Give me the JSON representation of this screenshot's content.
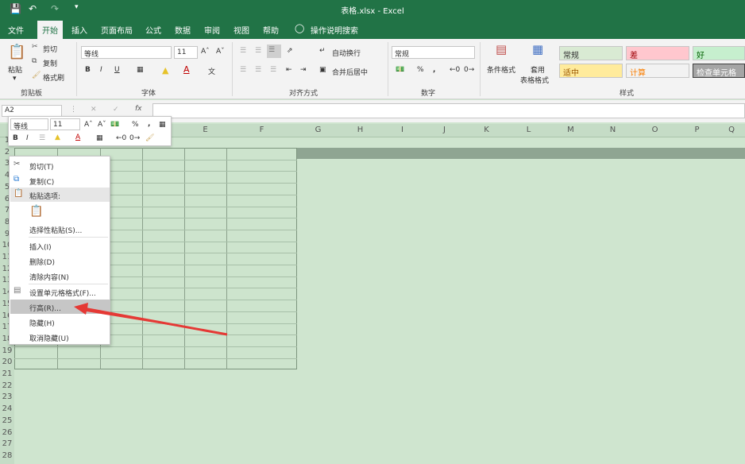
{
  "title_bar": {
    "title": "表格.xlsx  -  Excel"
  },
  "tabs": [
    "文件",
    "开始",
    "插入",
    "页面布局",
    "公式",
    "数据",
    "审阅",
    "视图",
    "帮助"
  ],
  "tell_me": "操作说明搜索",
  "clipboard": {
    "paste": "粘贴",
    "cut": "剪切",
    "copy": "复制",
    "format_painter": "格式刷",
    "label": "剪贴板"
  },
  "font": {
    "name": "等线",
    "size": "11",
    "label": "字体"
  },
  "alignment": {
    "wrap": "自动换行",
    "merge": "合并后居中",
    "label": "对齐方式"
  },
  "number": {
    "format": "常规",
    "label": "数字"
  },
  "styles": {
    "conditional": "条件格式",
    "table_format_1": "套用",
    "table_format_2": "表格格式",
    "label": "样式",
    "cells": [
      {
        "text": "常规",
        "bg": "#d9ead3",
        "fg": "#333333"
      },
      {
        "text": "差",
        "bg": "#ffc7ce",
        "fg": "#9c0006"
      },
      {
        "text": "好",
        "bg": "#c6efce",
        "fg": "#006100"
      },
      {
        "text": "适中",
        "bg": "#ffeb9c",
        "fg": "#9c5700"
      },
      {
        "text": "计算",
        "bg": "#f2f2f2",
        "fg": "#fa7d00"
      },
      {
        "text": "检查单元格",
        "bg": "#a5a5a5",
        "fg": "#ffffff"
      }
    ]
  },
  "formula_bar": {
    "name_box": "A2",
    "fx": "fx"
  },
  "columns": [
    "E",
    "F",
    "G",
    "H",
    "I",
    "J",
    "K",
    "L",
    "M",
    "N",
    "O",
    "P",
    "Q"
  ],
  "rows": [
    "1",
    "2",
    "3",
    "4",
    "5",
    "6",
    "7",
    "8",
    "9",
    "10",
    "11",
    "12",
    "13",
    "14",
    "15",
    "16",
    "17",
    "18",
    "19",
    "20",
    "21",
    "22",
    "23",
    "24",
    "25",
    "26",
    "27",
    "28"
  ],
  "mini_toolbar": {
    "font": "等线",
    "size": "11",
    "percent": "%",
    "comma": ","
  },
  "context_menu": {
    "items": [
      "剪切(T)",
      "复制(C)",
      "粘贴选项:",
      "选择性粘贴(S)...",
      "插入(I)",
      "删除(D)",
      "清除内容(N)",
      "设置单元格格式(F)...",
      "行高(R)...",
      "隐藏(H)",
      "取消隐藏(U)"
    ]
  },
  "colors": {
    "excel_green": "#217346",
    "arrow": "#e53935"
  }
}
